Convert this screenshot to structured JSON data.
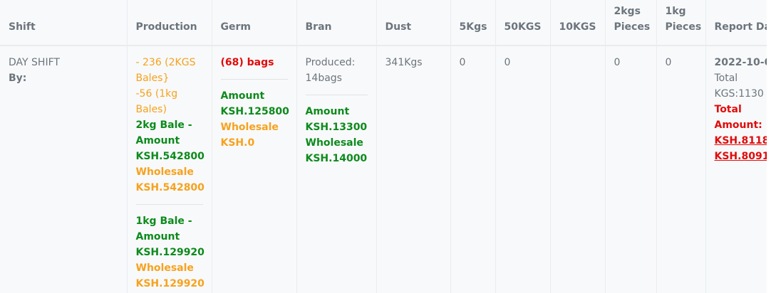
{
  "headers": {
    "shift": "Shift",
    "production": "Production",
    "germ": "Germ",
    "bran": "Bran",
    "dust": "Dust",
    "kg5": "5Kgs",
    "kg50": "50KGS",
    "kg10": "10KGS",
    "pieces2": [
      "2kgs",
      "Pieces"
    ],
    "pieces1": [
      "1kg",
      "Pieces"
    ],
    "report_date": "Report Da"
  },
  "row": {
    "shift": {
      "name": "DAY SHIFT",
      "by": "By:"
    },
    "production": {
      "bales2": "- 236 (2KGS Bales}",
      "bales1": "-56 (1kg Bales)",
      "bale2_amount_label": "2kg Bale -Amount",
      "bale2_amount": "KSH.542800",
      "bale2_wholesale_label": "Wholesale",
      "bale2_wholesale": "KSH.542800",
      "bale1_amount_label": "1kg Bale -Amount",
      "bale1_amount": "KSH.129920",
      "bale1_wholesale_label": "Wholesale",
      "bale1_wholesale": "KSH.129920"
    },
    "germ": {
      "bags": "(68) bags",
      "amount_label": "Amount",
      "amount": "KSH.125800",
      "wholesale_label": "Wholesale",
      "wholesale": "KSH.0"
    },
    "bran": {
      "produced": "Produced: 14bags",
      "amount_label": "Amount",
      "amount": "KSH.13300",
      "wholesale_label": "Wholesale",
      "wholesale": "KSH.14000"
    },
    "dust": "341Kgs",
    "kg5": "0",
    "kg50": "0",
    "kg10": "",
    "pieces2": "0",
    "pieces1": "0",
    "report": {
      "date": "2022-10-0",
      "total_kgs": "Total KGS:1130",
      "total_amount_label": "Total Amount:",
      "amount1": "KSH.8118",
      "amount2": "KSH.8091"
    }
  },
  "colors": {
    "orange": "#f6a21e",
    "green": "#0d8a1d",
    "red": "#e10b0b",
    "muted": "#6c757d"
  }
}
